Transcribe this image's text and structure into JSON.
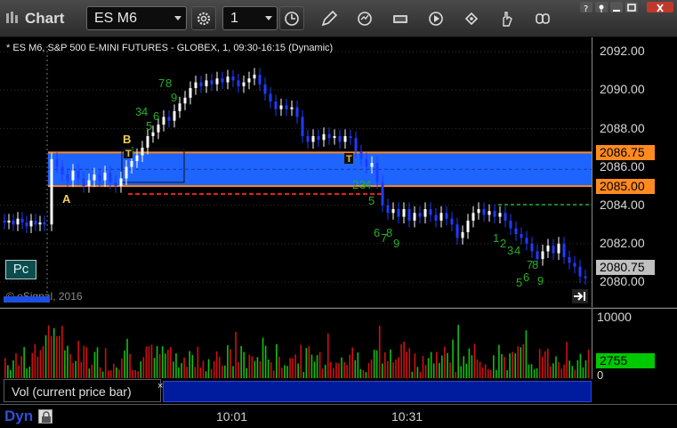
{
  "window": {
    "app_title": "Chart",
    "symbol": "ES M6",
    "interval": "1",
    "colors": {
      "titlebar": "#333333",
      "background": "#000000"
    }
  },
  "chart": {
    "title": "* ES M6, S&P 500 E-MINI FUTURES - GLOBEX, 1, 09:30-16:15 (Dynamic)",
    "copyright": "© eSignal, 2016",
    "pc_label": "Pc",
    "markers": [
      "A",
      "B"
    ],
    "price_labels": [
      "2092.00",
      "2090.00",
      "2088.00",
      "2086.00",
      "2084.00",
      "2082.00",
      "2080.00"
    ],
    "badges": [
      {
        "label": "2086.75",
        "color": "#ff8a1f"
      },
      {
        "label": "2085.00",
        "color": "#ff8a1f"
      },
      {
        "label": "2080.75",
        "color": "#c0c0c0"
      }
    ],
    "colors": {
      "opening_range": "#1e64ff",
      "range_border": "#ff8a1f",
      "up": "#ffffff",
      "down": "#1e3cff",
      "td_count": "#23b02a"
    }
  },
  "volume": {
    "legend": "Vol (current price bar)",
    "close_glyph": "×",
    "scale_labels": [
      "10000",
      "0"
    ],
    "current": {
      "label": "2755",
      "color": "#00c800"
    }
  },
  "timebar": {
    "dyn_label": "Dyn",
    "time_labels": [
      "10:01",
      "10:31"
    ]
  },
  "chart_data": {
    "type": "candlestick",
    "title": "* ES M6, S&P 500 E-MINI FUTURES - GLOBEX, 1, 09:30-16:15 (Dynamic)",
    "y_range": [
      2079.5,
      2093.0
    ],
    "y_ticks": [
      2080,
      2082,
      2084,
      2086,
      2088,
      2090,
      2092
    ],
    "x_labels": [
      "10:01",
      "10:31"
    ],
    "bar_interval_min": 1,
    "opening_range": {
      "high": 2086.75,
      "low": 2085.0
    },
    "last_price": 2080.75,
    "volume_range": [
      0,
      10000
    ],
    "last_volume": 2755
  }
}
